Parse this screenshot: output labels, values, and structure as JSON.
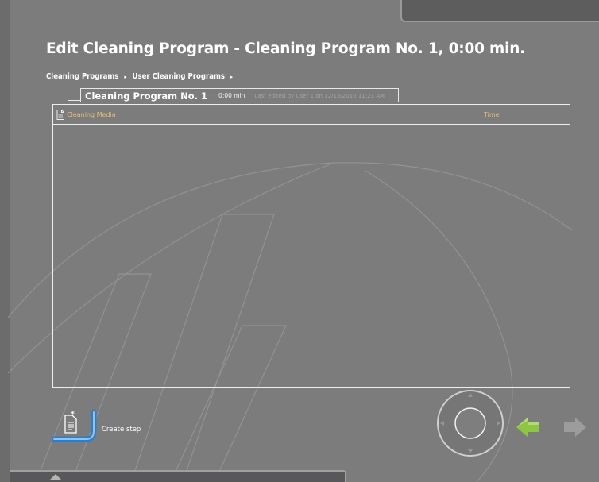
{
  "page": {
    "title": "Edit Cleaning Program - Cleaning Program No. 1, 0:00 min."
  },
  "breadcrumb": {
    "items": [
      "Cleaning Programs",
      "User Cleaning Programs"
    ],
    "separator": "▸"
  },
  "program": {
    "name": "Cleaning Program No. 1",
    "duration": "0:00 min",
    "last_edited": "Last edited by User 1 on 12/13/2010 11:23 AM"
  },
  "table": {
    "columns": [
      "Cleaning Media",
      "Time"
    ],
    "rows": []
  },
  "actions": {
    "create_step_label": "Create step"
  },
  "icons": {
    "document": "document-icon",
    "create_step": "create-step-icon",
    "joystick": "joystick-icon",
    "back": "back-arrow-icon",
    "forward": "forward-arrow-icon",
    "bottom_panel": "chevron-up-icon"
  },
  "colors": {
    "background": "#7c7c7d",
    "column_header": "#e5bd76",
    "accent_green": "#8ec63f",
    "accent_blue": "#2f7fc8"
  }
}
